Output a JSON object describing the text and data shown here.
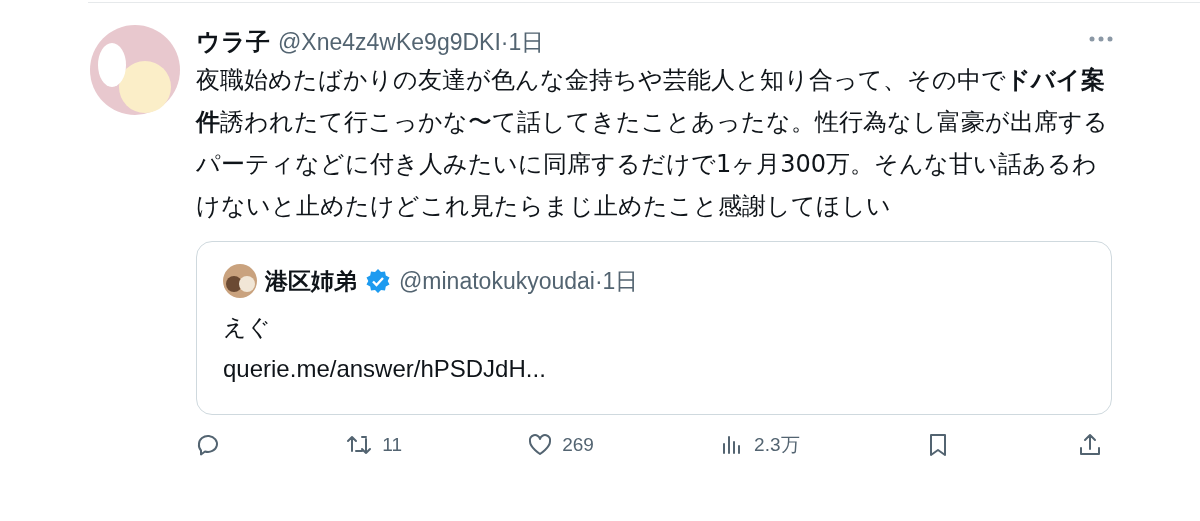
{
  "post": {
    "author_name": "ウラ子",
    "meta": "@Xne4z4wKe9g9DKI·1日",
    "text": "夜職始めたばかりの友達が色んな金持ちや芸能人と知り合って、その中で**ドバイ案件**誘われたて行こっかな〜て話してきたことあったな。性行為なし富豪が出席するパーティなどに付き人みたいに同席するだけで1ヶ月300万。そんな甘い話あるわけないと止めたけどこれ見たらまじ止めたこと感謝してほしい",
    "quote": {
      "author_name": "港区姉弟",
      "verified": true,
      "meta": "@minatokukyoudai·1日",
      "text": "えぐ",
      "link": "querie.me/answer/hPSDJdH..."
    },
    "actions": [
      {
        "kind": "reply"
      },
      {
        "kind": "repost",
        "count": "11"
      },
      {
        "kind": "like",
        "count": "269"
      },
      {
        "kind": "views",
        "count": "2.3万"
      },
      {
        "kind": "bookmark"
      },
      {
        "kind": "share"
      }
    ]
  }
}
